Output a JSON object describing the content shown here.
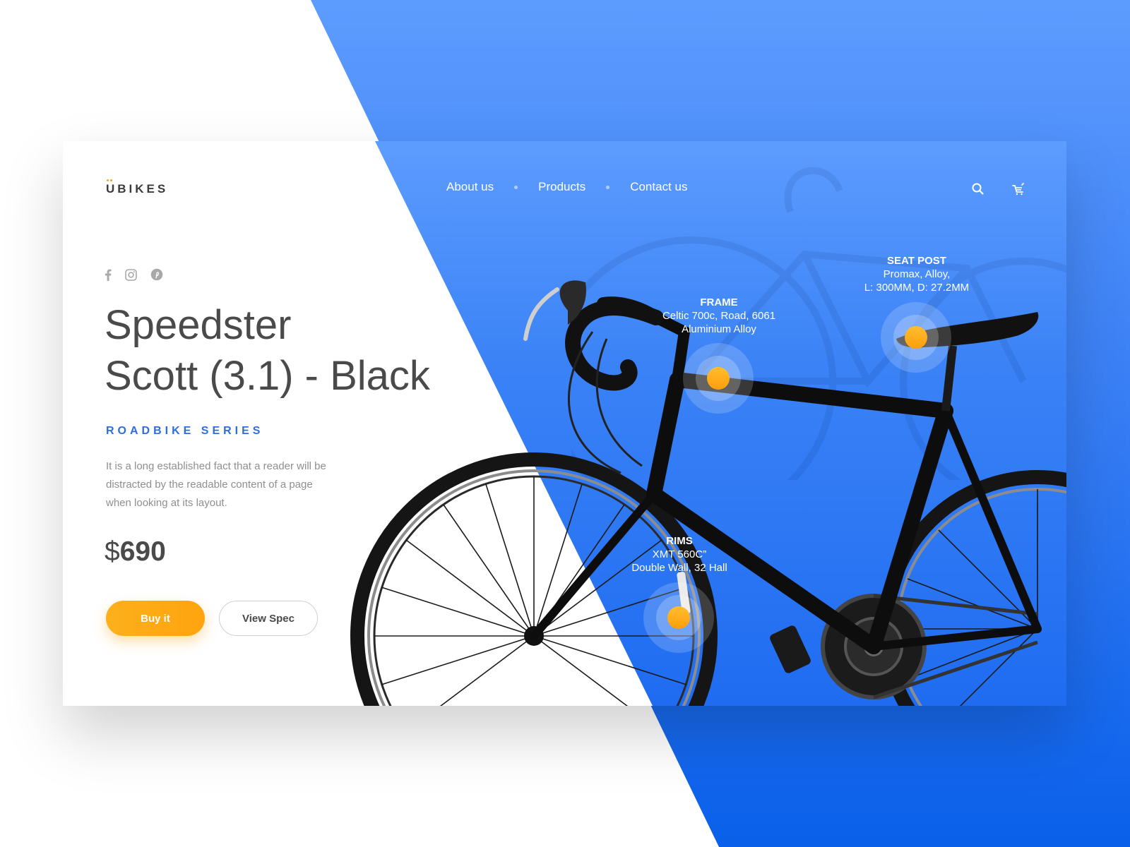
{
  "brand": {
    "name": "UBIKES"
  },
  "nav": {
    "items": [
      "About us",
      "Products",
      "Contact us"
    ]
  },
  "header_icons": {
    "search": "search-icon",
    "cart": "cart-icon"
  },
  "social": [
    "facebook-icon",
    "instagram-icon",
    "pinterest-icon"
  ],
  "product": {
    "title_line1": "Speedster",
    "title_line2": "Scott (3.1) - Black",
    "series": "ROADBIKE SERIES",
    "description": "It is a long established fact that a reader will be distracted by the readable content of a page when looking at its layout.",
    "currency": "$",
    "price": "690"
  },
  "actions": {
    "buy_label": "Buy it",
    "spec_label": "View Spec"
  },
  "specs": {
    "seat_post": {
      "title": "SEAT POST",
      "line1": "Promax, Alloy,",
      "line2": "L: 300MM, D: 27.2MM"
    },
    "frame": {
      "title": "FRAME",
      "line1": "Celtic 700c, Road, 6061",
      "line2": "Aluminium Alloy"
    },
    "rims": {
      "title": "RIMS",
      "line1": "XMT 560C”",
      "line2": "Double Wall, 32 Hall"
    }
  },
  "colors": {
    "accent": "#ffa40f",
    "primary_blue": "#1f6cf1",
    "series_text": "#2f6ddf"
  }
}
